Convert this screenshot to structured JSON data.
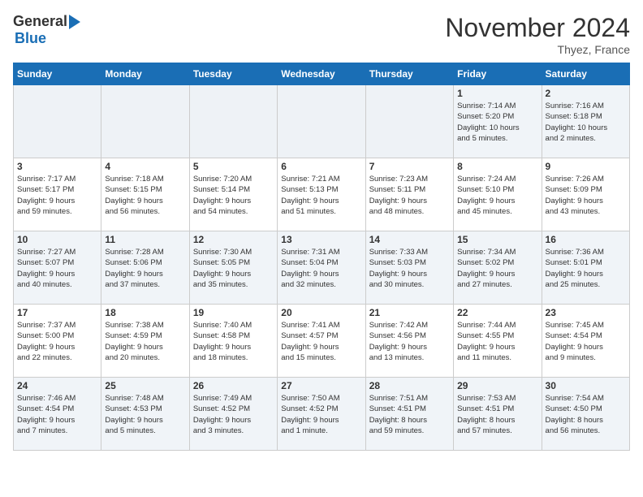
{
  "logo": {
    "general": "General",
    "blue": "Blue"
  },
  "header": {
    "month_year": "November 2024",
    "location": "Thyez, France"
  },
  "weekdays": [
    "Sunday",
    "Monday",
    "Tuesday",
    "Wednesday",
    "Thursday",
    "Friday",
    "Saturday"
  ],
  "weeks": [
    [
      {
        "day": "",
        "info": ""
      },
      {
        "day": "",
        "info": ""
      },
      {
        "day": "",
        "info": ""
      },
      {
        "day": "",
        "info": ""
      },
      {
        "day": "",
        "info": ""
      },
      {
        "day": "1",
        "info": "Sunrise: 7:14 AM\nSunset: 5:20 PM\nDaylight: 10 hours\nand 5 minutes."
      },
      {
        "day": "2",
        "info": "Sunrise: 7:16 AM\nSunset: 5:18 PM\nDaylight: 10 hours\nand 2 minutes."
      }
    ],
    [
      {
        "day": "3",
        "info": "Sunrise: 7:17 AM\nSunset: 5:17 PM\nDaylight: 9 hours\nand 59 minutes."
      },
      {
        "day": "4",
        "info": "Sunrise: 7:18 AM\nSunset: 5:15 PM\nDaylight: 9 hours\nand 56 minutes."
      },
      {
        "day": "5",
        "info": "Sunrise: 7:20 AM\nSunset: 5:14 PM\nDaylight: 9 hours\nand 54 minutes."
      },
      {
        "day": "6",
        "info": "Sunrise: 7:21 AM\nSunset: 5:13 PM\nDaylight: 9 hours\nand 51 minutes."
      },
      {
        "day": "7",
        "info": "Sunrise: 7:23 AM\nSunset: 5:11 PM\nDaylight: 9 hours\nand 48 minutes."
      },
      {
        "day": "8",
        "info": "Sunrise: 7:24 AM\nSunset: 5:10 PM\nDaylight: 9 hours\nand 45 minutes."
      },
      {
        "day": "9",
        "info": "Sunrise: 7:26 AM\nSunset: 5:09 PM\nDaylight: 9 hours\nand 43 minutes."
      }
    ],
    [
      {
        "day": "10",
        "info": "Sunrise: 7:27 AM\nSunset: 5:07 PM\nDaylight: 9 hours\nand 40 minutes."
      },
      {
        "day": "11",
        "info": "Sunrise: 7:28 AM\nSunset: 5:06 PM\nDaylight: 9 hours\nand 37 minutes."
      },
      {
        "day": "12",
        "info": "Sunrise: 7:30 AM\nSunset: 5:05 PM\nDaylight: 9 hours\nand 35 minutes."
      },
      {
        "day": "13",
        "info": "Sunrise: 7:31 AM\nSunset: 5:04 PM\nDaylight: 9 hours\nand 32 minutes."
      },
      {
        "day": "14",
        "info": "Sunrise: 7:33 AM\nSunset: 5:03 PM\nDaylight: 9 hours\nand 30 minutes."
      },
      {
        "day": "15",
        "info": "Sunrise: 7:34 AM\nSunset: 5:02 PM\nDaylight: 9 hours\nand 27 minutes."
      },
      {
        "day": "16",
        "info": "Sunrise: 7:36 AM\nSunset: 5:01 PM\nDaylight: 9 hours\nand 25 minutes."
      }
    ],
    [
      {
        "day": "17",
        "info": "Sunrise: 7:37 AM\nSunset: 5:00 PM\nDaylight: 9 hours\nand 22 minutes."
      },
      {
        "day": "18",
        "info": "Sunrise: 7:38 AM\nSunset: 4:59 PM\nDaylight: 9 hours\nand 20 minutes."
      },
      {
        "day": "19",
        "info": "Sunrise: 7:40 AM\nSunset: 4:58 PM\nDaylight: 9 hours\nand 18 minutes."
      },
      {
        "day": "20",
        "info": "Sunrise: 7:41 AM\nSunset: 4:57 PM\nDaylight: 9 hours\nand 15 minutes."
      },
      {
        "day": "21",
        "info": "Sunrise: 7:42 AM\nSunset: 4:56 PM\nDaylight: 9 hours\nand 13 minutes."
      },
      {
        "day": "22",
        "info": "Sunrise: 7:44 AM\nSunset: 4:55 PM\nDaylight: 9 hours\nand 11 minutes."
      },
      {
        "day": "23",
        "info": "Sunrise: 7:45 AM\nSunset: 4:54 PM\nDaylight: 9 hours\nand 9 minutes."
      }
    ],
    [
      {
        "day": "24",
        "info": "Sunrise: 7:46 AM\nSunset: 4:54 PM\nDaylight: 9 hours\nand 7 minutes."
      },
      {
        "day": "25",
        "info": "Sunrise: 7:48 AM\nSunset: 4:53 PM\nDaylight: 9 hours\nand 5 minutes."
      },
      {
        "day": "26",
        "info": "Sunrise: 7:49 AM\nSunset: 4:52 PM\nDaylight: 9 hours\nand 3 minutes."
      },
      {
        "day": "27",
        "info": "Sunrise: 7:50 AM\nSunset: 4:52 PM\nDaylight: 9 hours\nand 1 minute."
      },
      {
        "day": "28",
        "info": "Sunrise: 7:51 AM\nSunset: 4:51 PM\nDaylight: 8 hours\nand 59 minutes."
      },
      {
        "day": "29",
        "info": "Sunrise: 7:53 AM\nSunset: 4:51 PM\nDaylight: 8 hours\nand 57 minutes."
      },
      {
        "day": "30",
        "info": "Sunrise: 7:54 AM\nSunset: 4:50 PM\nDaylight: 8 hours\nand 56 minutes."
      }
    ]
  ]
}
